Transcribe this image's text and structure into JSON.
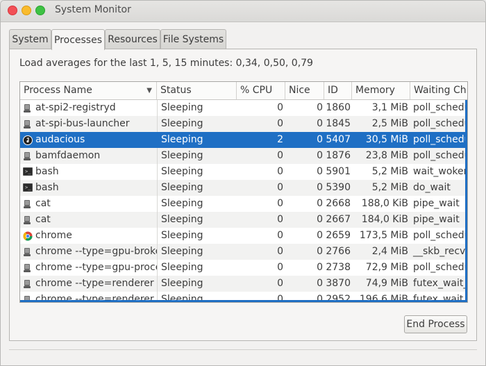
{
  "window": {
    "title": "System Monitor"
  },
  "tabs": [
    {
      "label": "System",
      "active": false
    },
    {
      "label": "Processes",
      "active": true
    },
    {
      "label": "Resources",
      "active": false
    },
    {
      "label": "File Systems",
      "active": false
    }
  ],
  "load_averages": "Load averages for the last 1, 5, 15 minutes: 0,34, 0,50, 0,79",
  "table": {
    "columns": [
      "Process Name",
      "Status",
      "% CPU",
      "Nice",
      "ID",
      "Memory",
      "Waiting Ch"
    ],
    "rows": [
      {
        "name": "at-spi2-registryd",
        "status": "Sleeping",
        "cpu": "0",
        "nice": "0",
        "id": "1860",
        "memory": "3,1 MiB",
        "waiting": "poll_schedu",
        "icon": "generic-process-icon"
      },
      {
        "name": "at-spi-bus-launcher",
        "status": "Sleeping",
        "cpu": "0",
        "nice": "0",
        "id": "1845",
        "memory": "2,5 MiB",
        "waiting": "poll_schedu",
        "icon": "generic-process-icon"
      },
      {
        "name": "audacious",
        "status": "Sleeping",
        "cpu": "2",
        "nice": "0",
        "id": "5407",
        "memory": "30,5 MiB",
        "waiting": "poll_schedu",
        "icon": "audacious-icon",
        "selected": true
      },
      {
        "name": "bamfdaemon",
        "status": "Sleeping",
        "cpu": "0",
        "nice": "0",
        "id": "1876",
        "memory": "23,8 MiB",
        "waiting": "poll_schedu",
        "icon": "generic-process-icon"
      },
      {
        "name": "bash",
        "status": "Sleeping",
        "cpu": "0",
        "nice": "0",
        "id": "5901",
        "memory": "5,2 MiB",
        "waiting": "wait_woken",
        "icon": "terminal-icon"
      },
      {
        "name": "bash",
        "status": "Sleeping",
        "cpu": "0",
        "nice": "0",
        "id": "5390",
        "memory": "5,2 MiB",
        "waiting": "do_wait",
        "icon": "terminal-icon"
      },
      {
        "name": "cat",
        "status": "Sleeping",
        "cpu": "0",
        "nice": "0",
        "id": "2668",
        "memory": "188,0 KiB",
        "waiting": "pipe_wait",
        "icon": "generic-process-icon"
      },
      {
        "name": "cat",
        "status": "Sleeping",
        "cpu": "0",
        "nice": "0",
        "id": "2667",
        "memory": "184,0 KiB",
        "waiting": "pipe_wait",
        "icon": "generic-process-icon"
      },
      {
        "name": "chrome",
        "status": "Sleeping",
        "cpu": "0",
        "nice": "0",
        "id": "2659",
        "memory": "173,5 MiB",
        "waiting": "poll_schedu",
        "icon": "chrome-icon"
      },
      {
        "name": "chrome --type=gpu-broker",
        "status": "Sleeping",
        "cpu": "0",
        "nice": "0",
        "id": "2766",
        "memory": "2,4 MiB",
        "waiting": "__skb_recv_",
        "icon": "generic-process-icon"
      },
      {
        "name": "chrome --type=gpu-process",
        "status": "Sleeping",
        "cpu": "0",
        "nice": "0",
        "id": "2738",
        "memory": "72,9 MiB",
        "waiting": "poll_schedu",
        "icon": "generic-process-icon"
      },
      {
        "name": "chrome --type=renderer --l",
        "status": "Sleeping",
        "cpu": "0",
        "nice": "0",
        "id": "3870",
        "memory": "74,9 MiB",
        "waiting": "futex_wait_",
        "icon": "generic-process-icon"
      },
      {
        "name": "chrome --type=renderer --l",
        "status": "Sleeping",
        "cpu": "0",
        "nice": "0",
        "id": "2952",
        "memory": "196,6 MiB",
        "waiting": "futex_wait_",
        "icon": "generic-process-icon"
      }
    ]
  },
  "buttons": {
    "end_process": "End Process"
  },
  "colors": {
    "selection": "#1f6fc4",
    "close": "#f25056",
    "minimize": "#f9bb2d",
    "maximize": "#3ec244"
  }
}
